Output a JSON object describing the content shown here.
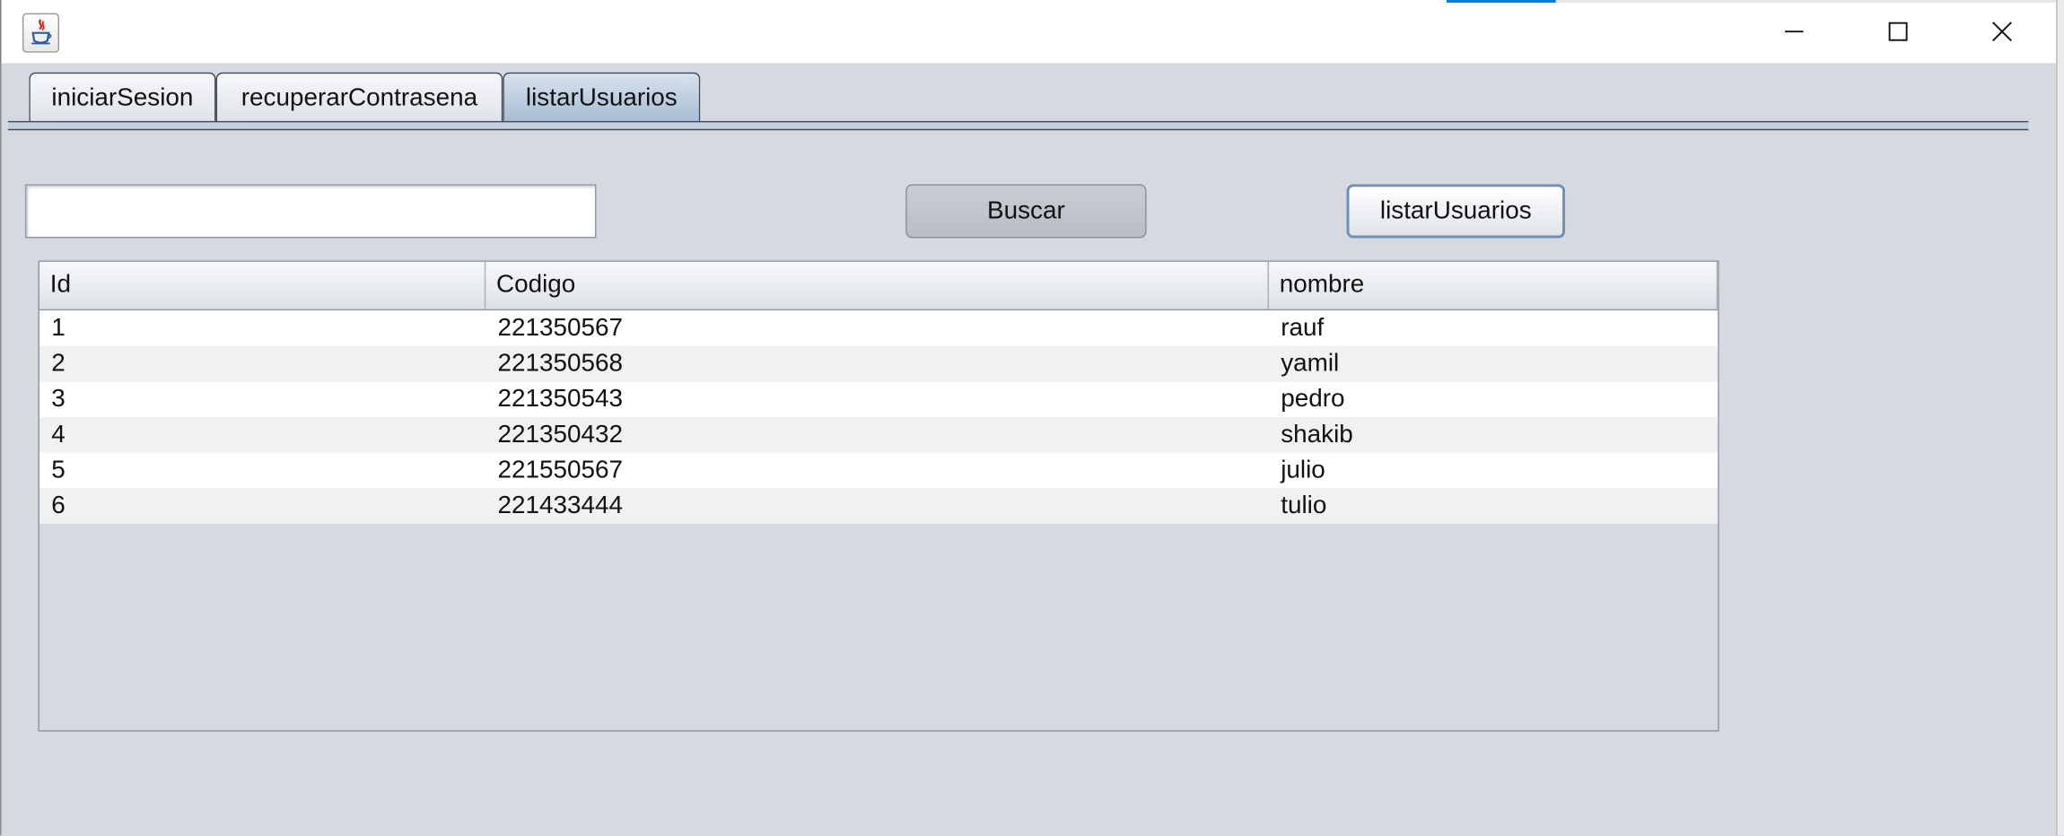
{
  "window": {
    "app_icon": "java-cup-icon",
    "controls": [
      "minimize-icon",
      "maximize-icon",
      "close-icon"
    ]
  },
  "tabs": [
    {
      "label": "iniciarSesion",
      "active": false
    },
    {
      "label": "recuperarContrasena",
      "active": false
    },
    {
      "label": "listarUsuarios",
      "active": true
    }
  ],
  "search": {
    "value": "",
    "button_label": "Buscar"
  },
  "list_button_label": "listarUsuarios",
  "table": {
    "columns": [
      "Id",
      "Codigo",
      "nombre"
    ],
    "rows": [
      {
        "id": "1",
        "codigo": "221350567",
        "nombre": "rauf"
      },
      {
        "id": "2",
        "codigo": "221350568",
        "nombre": "yamil"
      },
      {
        "id": "3",
        "codigo": "221350543",
        "nombre": "pedro"
      },
      {
        "id": "4",
        "codigo": "221350432",
        "nombre": "shakib"
      },
      {
        "id": "5",
        "codigo": "221550567",
        "nombre": "julio"
      },
      {
        "id": "6",
        "codigo": "221433444",
        "nombre": "tulio"
      }
    ]
  },
  "colors": {
    "background": "#d6d9df",
    "active_tab": "#a7bdd4",
    "focus_border": "#6f8fb6"
  }
}
